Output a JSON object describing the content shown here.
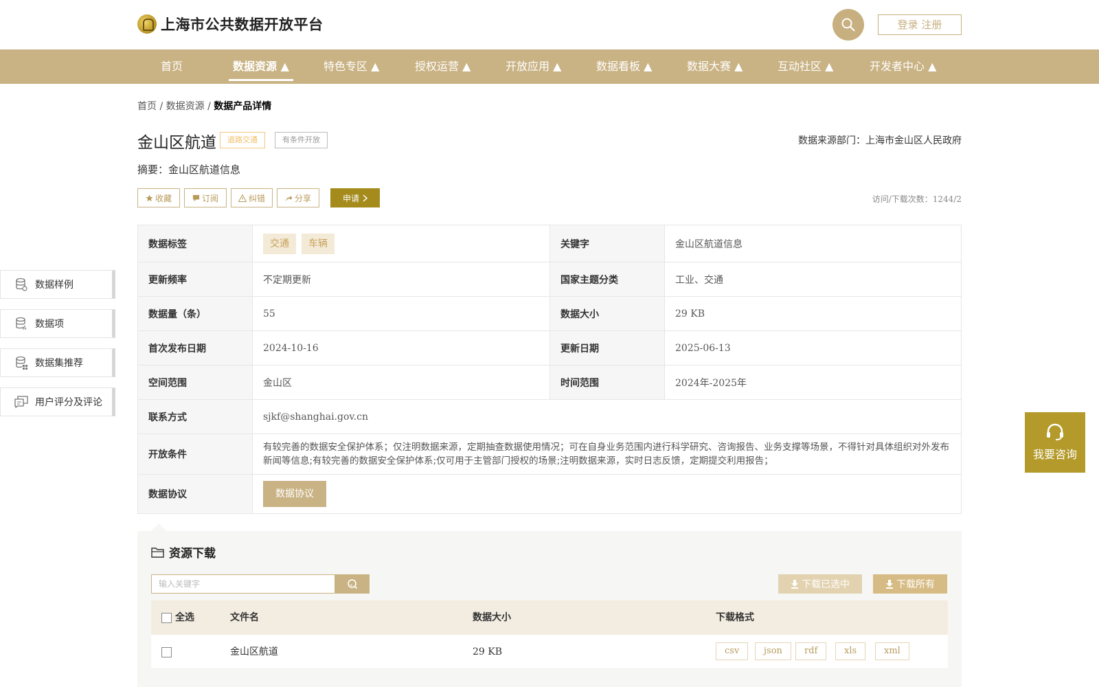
{
  "header": {
    "logo_text": "上海市公共数据开放平台",
    "login_label": "登录 注册"
  },
  "nav": {
    "items": [
      "首页",
      "数据资源 ▲",
      "特色专区 ▲",
      "授权运营 ▲",
      "开放应用 ▲",
      "数据看板 ▲",
      "数据大赛 ▲",
      "互动社区 ▲",
      "开发者中心 ▲"
    ],
    "active_index": 1
  },
  "breadcrumb": {
    "home": "首页",
    "sep": "/",
    "section": "数据资源",
    "current": "数据产品详情"
  },
  "dataset": {
    "title": "金山区航道",
    "category_tag": "道路交通",
    "open_tag": "有条件开放",
    "source": "数据来源部门：上海市金山区人民政府",
    "summary": "摘要：金山区航道信息",
    "visits": "访问/下载次数：1244/2"
  },
  "actions": {
    "favorite": "收藏",
    "subscribe": "订阅",
    "report": "纠错",
    "share": "分享",
    "apply": "申请"
  },
  "info": {
    "tags_label": "数据标签",
    "tags": [
      "交通",
      "车辆"
    ],
    "keyword_label": "关键字",
    "keyword": "金山区航道信息",
    "freq_label": "更新频率",
    "freq": "不定期更新",
    "theme_label": "国家主题分类",
    "theme": "工业、交通",
    "count_label": "数据量（条）",
    "count": "55",
    "size_label": "数据大小",
    "size": "29 KB",
    "first_pub_label": "首次发布日期",
    "first_pub": "2024-10-16",
    "update_label": "更新日期",
    "update": "2025-06-13",
    "space_label": "空间范围",
    "space": "金山区",
    "time_label": "时间范围",
    "time": "2024年-2025年",
    "contact_label": "联系方式",
    "contact": "sjkf@shanghai.gov.cn",
    "condition_label": "开放条件",
    "condition": "有较完善的数据安全保护体系；仅注明数据来源，定期抽查数据使用情况；可在自身业务范围内进行科学研究、咨询报告、业务支撑等场景，不得针对具体组织对外发布新闻等信息;有较完善的数据安全保护体系;仅可用于主管部门授权的场景;注明数据来源，实时日志反馈，定期提交利用报告；",
    "protocol_label": "数据协议",
    "protocol_btn": "数据协议"
  },
  "side_menu": [
    "数据样例",
    "数据项",
    "数据集推荐",
    "用户评分及评论"
  ],
  "consult": "我要咨询",
  "download": {
    "title": "资源下载",
    "search_placeholder": "输入关键字",
    "download_selected": "下载已选中",
    "download_all": "下载所有",
    "columns": {
      "select_all": "全选",
      "filename": "文件名",
      "size": "数据大小",
      "format": "下载格式"
    },
    "rows": [
      {
        "filename": "金山区航道",
        "size": "29 KB",
        "formats": [
          "csv",
          "json",
          "rdf",
          "xls",
          "xml"
        ]
      }
    ]
  }
}
